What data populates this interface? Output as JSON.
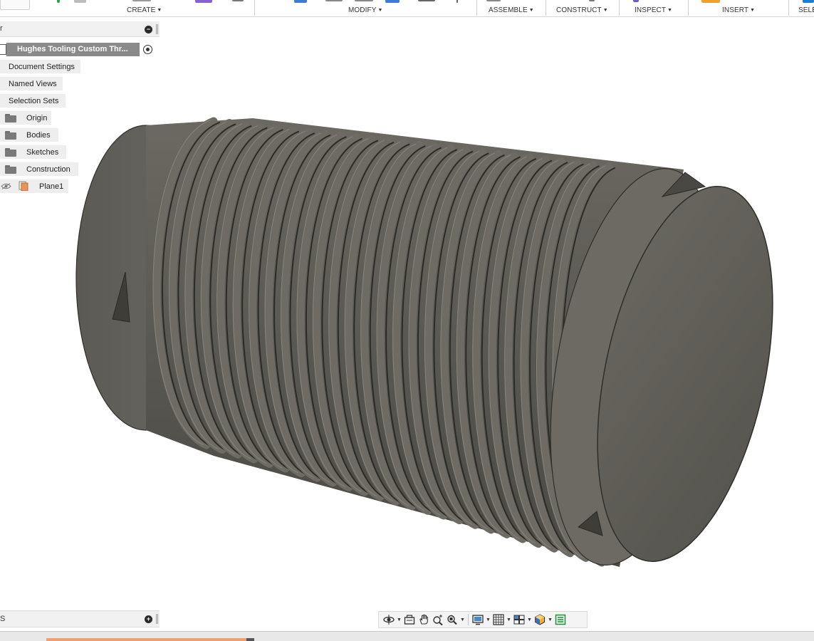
{
  "toolbar": {
    "create": "CREATE",
    "modify": "MODIFY",
    "assemble": "ASSEMBLE",
    "construct": "CONSTRUCT",
    "inspect": "INSPECT",
    "insert": "INSERT",
    "select": "SELE"
  },
  "browser": {
    "header_label": "r",
    "root_label": "Hughes Tooling Custom Thr...",
    "items": [
      {
        "label": "Document Settings"
      },
      {
        "label": "Named Views"
      },
      {
        "label": "Selection Sets"
      },
      {
        "label": "Origin"
      },
      {
        "label": "Bodies"
      },
      {
        "label": "Sketches"
      },
      {
        "label": "Construction"
      },
      {
        "label": "Plane1"
      }
    ]
  },
  "comments": {
    "header_label": "S"
  },
  "navbar": {
    "tools": [
      "orbit-icon",
      "look-at-icon",
      "pan-icon",
      "zoom-icon",
      "fit-icon",
      "display-settings-icon",
      "grid-icon",
      "viewports-icon",
      "environment-icon",
      "timeline-toggle-icon"
    ]
  },
  "colors": {
    "model_body": "#5a5852",
    "model_dark": "#3e3c36",
    "accent_orange": "#f0a070",
    "tree_bg": "#eeeeee",
    "root_bg": "#8a8a8a"
  }
}
